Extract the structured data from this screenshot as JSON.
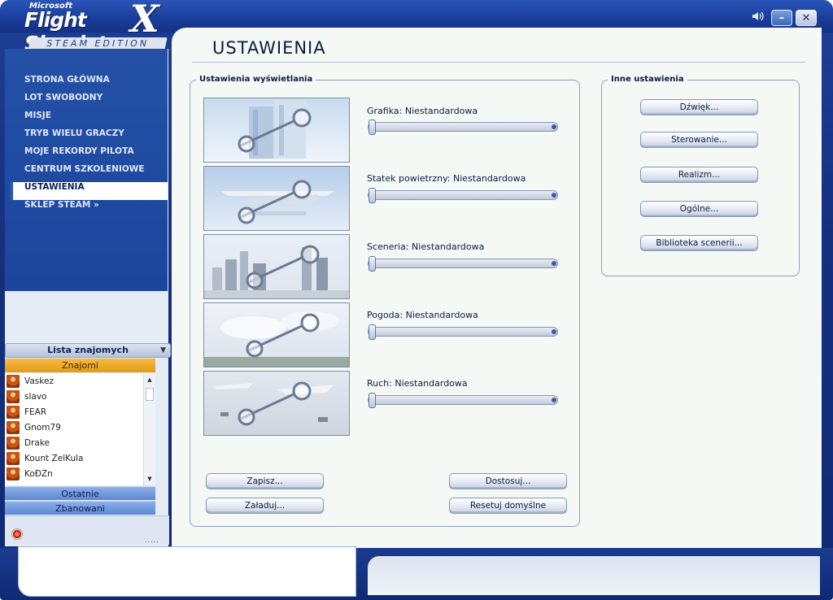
{
  "app": {
    "logo_top": "Microsoft",
    "logo_main": "Flight Simulator",
    "logo_x": "X",
    "logo_edition": "STEAM EDITION"
  },
  "window_controls": {
    "sound_icon": "speaker-icon",
    "minimize": "–",
    "close": "✕"
  },
  "nav": {
    "items": [
      {
        "label": "STRONA GŁÓWNA",
        "active": false
      },
      {
        "label": "LOT SWOBODNY",
        "active": false
      },
      {
        "label": "MISJE",
        "active": false
      },
      {
        "label": "TRYB WIELU GRACZY",
        "active": false
      },
      {
        "label": "MOJE REKORDY PILOTA",
        "active": false
      },
      {
        "label": "CENTRUM SZKOLENIOWE",
        "active": false
      },
      {
        "label": "USTAWIENIA",
        "active": true
      },
      {
        "label": "SKLEP STEAM »",
        "active": false
      }
    ]
  },
  "friends": {
    "header": "Lista znajomych",
    "section_known": "Znajomi",
    "list": [
      "Vaskez",
      "slavo",
      "FEAR",
      "Gnom79",
      "Drake",
      "Kount ZelKula",
      "KoĐZn"
    ],
    "section_recent": "Ostatnie",
    "section_banned": "Zbanowani",
    "grip": "....."
  },
  "page": {
    "title": "USTAWIENIA"
  },
  "display": {
    "group_label": "Ustawienia wyświetlania",
    "settings": [
      {
        "label": "Grafika: Niestandardowa",
        "image": "graphics-wrench-image",
        "level": 0
      },
      {
        "label": "Statek powietrzny: Niestandardowa",
        "image": "aircraft-wrench-image",
        "level": 0
      },
      {
        "label": "Sceneria: Niestandardowa",
        "image": "scenery-wrench-image",
        "level": 0
      },
      {
        "label": "Pogoda: Niestandardowa",
        "image": "weather-wrench-image",
        "level": 0
      },
      {
        "label": "Ruch: Niestandardowa",
        "image": "traffic-wrench-image",
        "level": 0
      }
    ],
    "buttons": {
      "save": "Zapisz...",
      "load": "Załaduj...",
      "customize": "Dostosuj...",
      "reset": "Resetuj domyślne"
    }
  },
  "other": {
    "group_label": "Inne ustawienia",
    "buttons": [
      "Dźwięk...",
      "Sterowanie...",
      "Realizm...",
      "Ogólne...",
      "Biblioteka scenerii..."
    ]
  },
  "colors": {
    "frame_blue": "#1a3d9a",
    "content_bg": "#f4f9f6",
    "accent_orange": "#f0a92a"
  }
}
